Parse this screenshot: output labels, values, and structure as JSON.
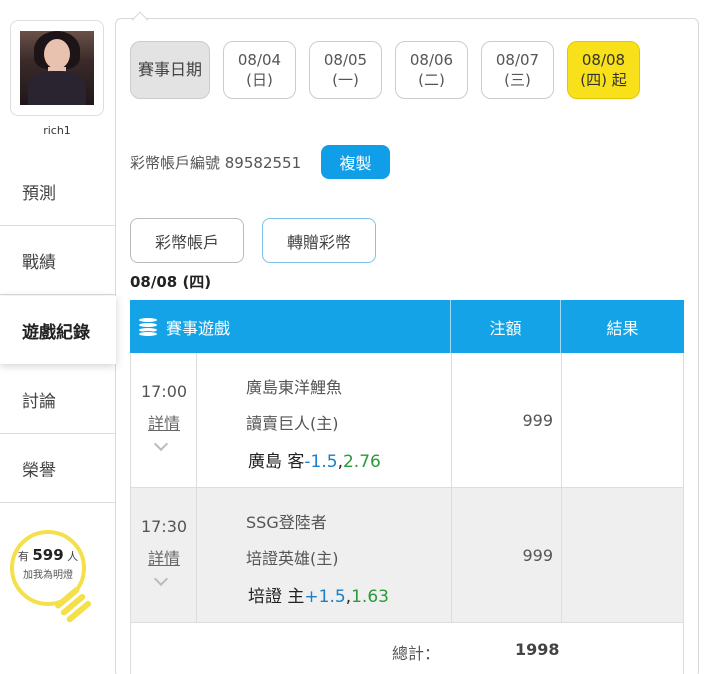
{
  "user": {
    "name": "rich1"
  },
  "nav": [
    {
      "label": "預測"
    },
    {
      "label": "戰績"
    },
    {
      "label": "遊戲紀錄"
    },
    {
      "label": "討論"
    },
    {
      "label": "榮譽"
    }
  ],
  "lightbulb": {
    "prefix": "有",
    "count": "599",
    "unit": "人",
    "caption": "加我為明燈"
  },
  "dates": {
    "label": "賽事日期",
    "items": [
      {
        "date": "08/04",
        "day": "(日)"
      },
      {
        "date": "08/05",
        "day": "(一)"
      },
      {
        "date": "08/06",
        "day": "(二)"
      },
      {
        "date": "08/07",
        "day": "(三)"
      },
      {
        "date": "08/08",
        "day": "(四) 起"
      }
    ]
  },
  "account": {
    "text": "彩幣帳戶編號 89582551",
    "copy_label": "複製"
  },
  "tabs": [
    {
      "label": "彩幣帳戶"
    },
    {
      "label": "轉贈彩幣"
    }
  ],
  "day_title": "08/08 (四)",
  "table": {
    "headers": {
      "game": "賽事遊戲",
      "bet": "注額",
      "result": "結果"
    },
    "rows": [
      {
        "time": "17:00",
        "detail": "詳情",
        "away": "廣島東洋鯉魚",
        "home": "讀賣巨人(主)",
        "pick_team": "廣島 客",
        "pick_hc": "-1.5",
        "pick_sep": ",",
        "pick_odd": "2.76",
        "bet": "999",
        "result": ""
      },
      {
        "time": "17:30",
        "detail": "詳情",
        "away": "SSG登陸者",
        "home": "培證英雄(主)",
        "pick_team": "培證 主",
        "pick_hc": "+1.5",
        "pick_sep": ",",
        "pick_odd": "1.63",
        "bet": "999",
        "result": ""
      }
    ],
    "total_label": "總計：",
    "total_value": "1998"
  },
  "colors": {
    "accent": "#13a3e6",
    "active_date": "#f8e11a",
    "bulb": "#f4e04a"
  }
}
